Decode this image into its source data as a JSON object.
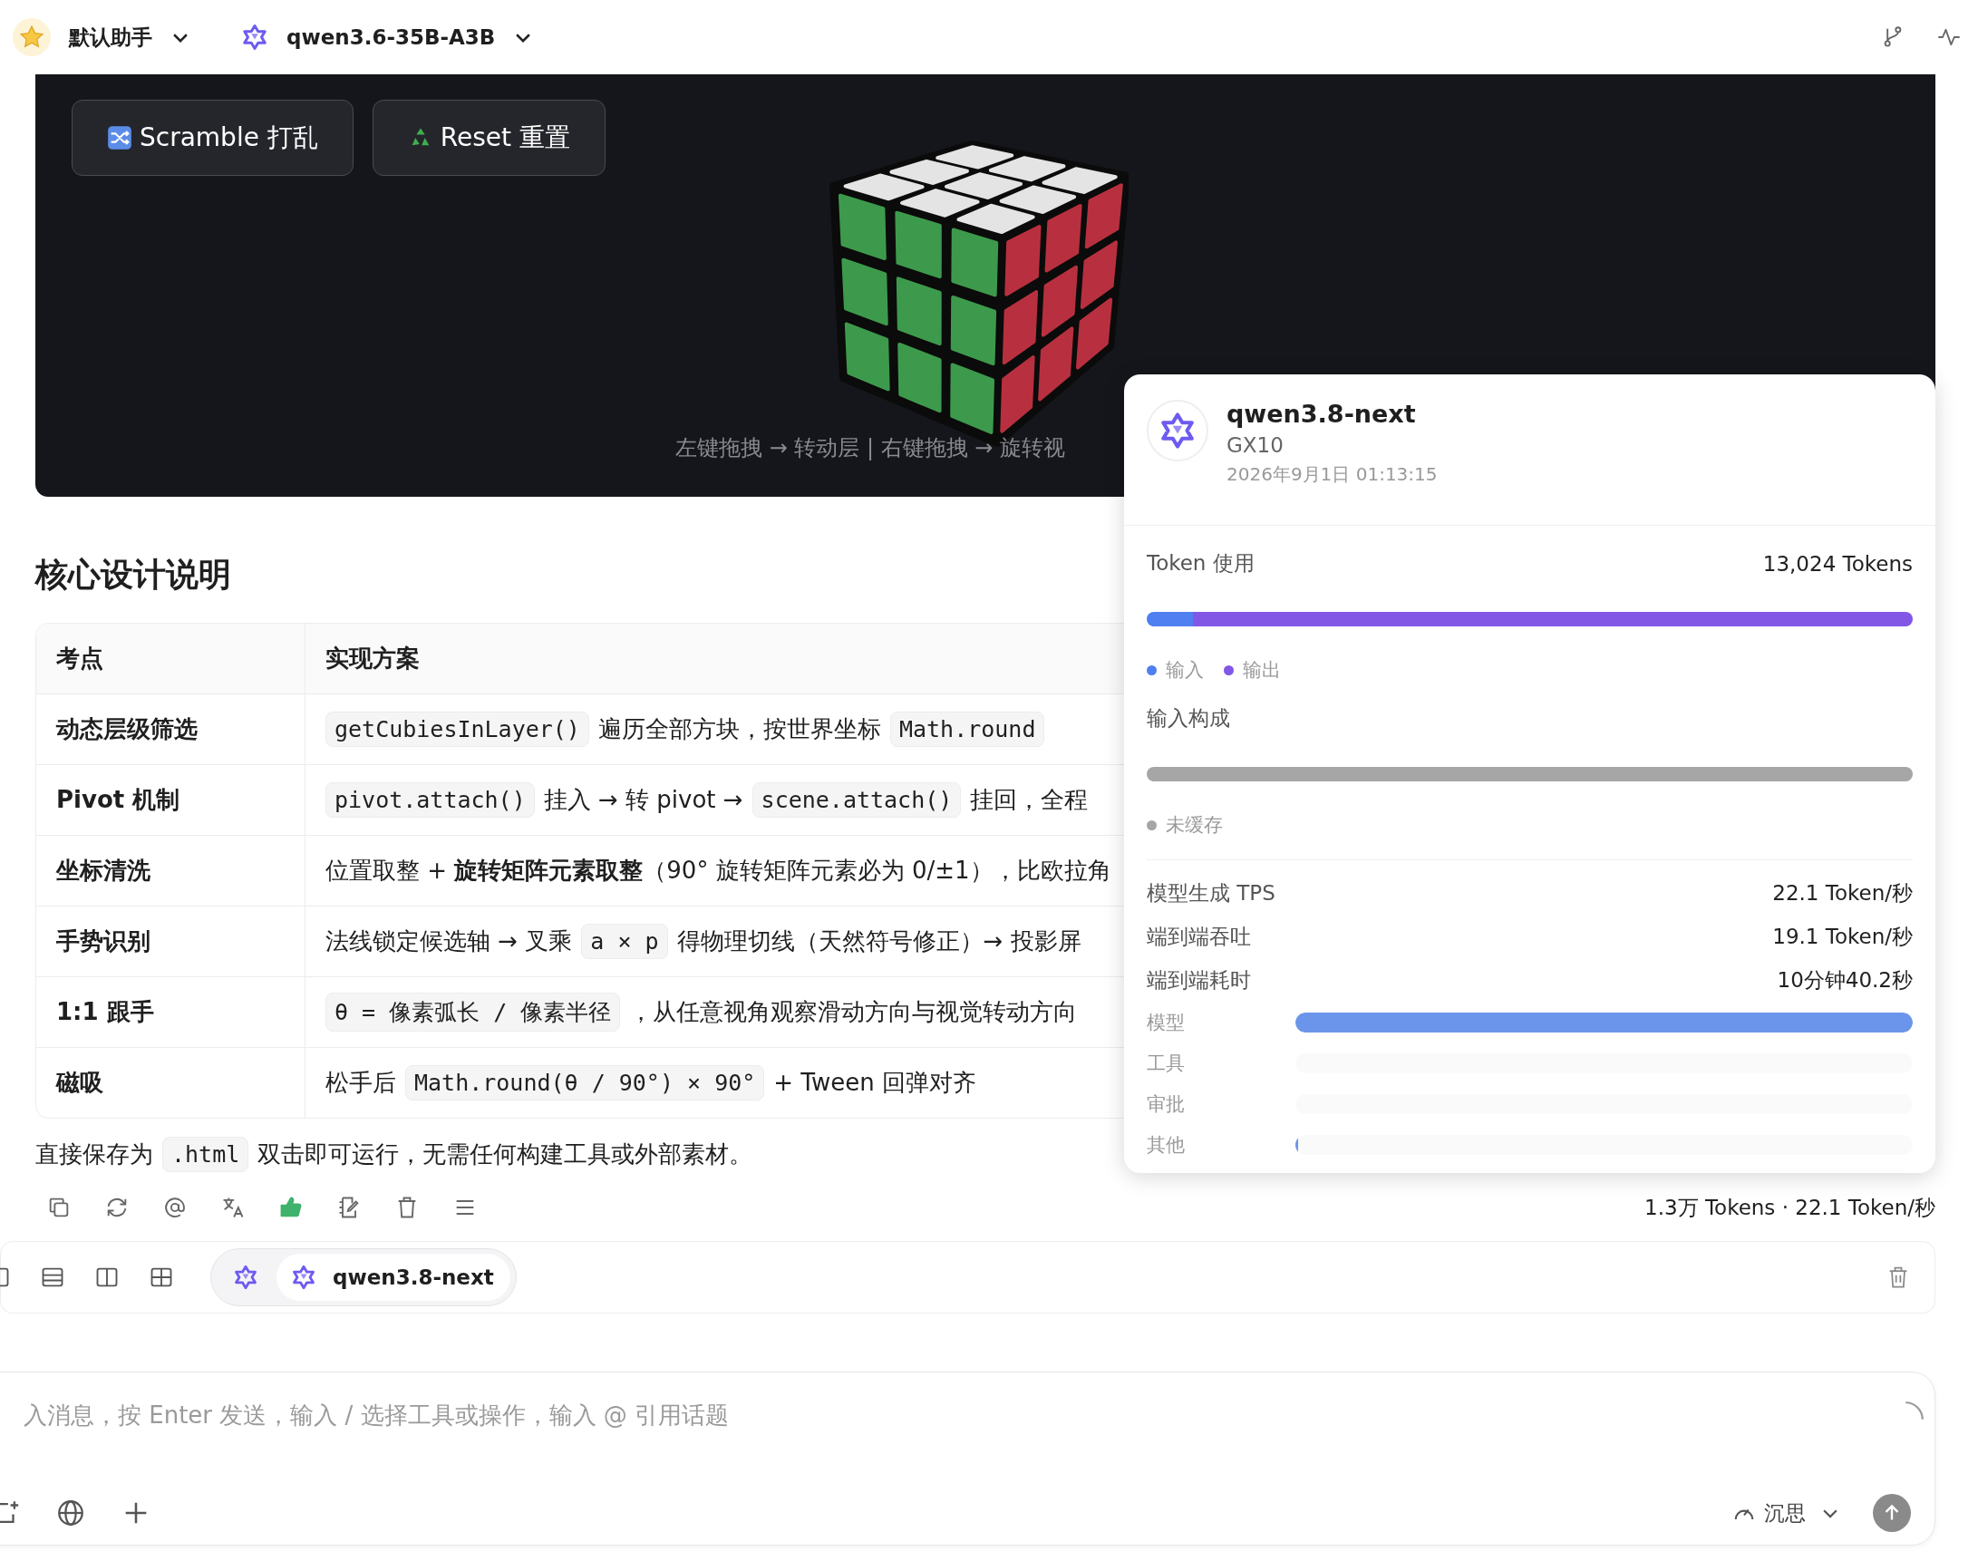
{
  "top_bar": {
    "assistant": "默认助手",
    "model": "qwen3.6-35B-A3B"
  },
  "demo": {
    "buttons": [
      {
        "kind": "shuffle",
        "label": "Scramble 打乱"
      },
      {
        "kind": "recycle",
        "label": "Reset 重置"
      }
    ],
    "hint": "左键拖拽 → 转动层 | 右键拖拽 → 旋转视"
  },
  "section_title": "核心设计说明",
  "table": {
    "columns": [
      "考点",
      "实现方案"
    ],
    "rows": [
      {
        "label": "动态层级筛选",
        "parts": [
          {
            "kind": "code",
            "text": "getCubiesInLayer()"
          },
          {
            "kind": "text",
            "text": "遍历全部方块，按世界坐标"
          },
          {
            "kind": "code",
            "text": "Math.round"
          }
        ]
      },
      {
        "label": "Pivot 机制",
        "parts": [
          {
            "kind": "code",
            "text": "pivot.attach()"
          },
          {
            "kind": "text",
            "text": "挂入 → 转 pivot →"
          },
          {
            "kind": "code",
            "text": "scene.attach()"
          },
          {
            "kind": "text",
            "text": "挂回，全程"
          }
        ]
      },
      {
        "label": "坐标清洗",
        "parts": [
          {
            "kind": "text",
            "text": "位置取整 + **旋转矩阵元素取整**（90° 旋转矩阵元素必为 0/±1），比欧拉角"
          }
        ]
      },
      {
        "label": "手势识别",
        "parts": [
          {
            "kind": "text",
            "text": "法线锁定候选轴 → 叉乘"
          },
          {
            "kind": "code",
            "text": "a × p"
          },
          {
            "kind": "text",
            "text": "得物理切线（天然符号修正）→ 投影屏"
          }
        ]
      },
      {
        "label": "1:1 跟手",
        "parts": [
          {
            "kind": "code",
            "text": "θ = 像素弧长 / 像素半径"
          },
          {
            "kind": "text",
            "text": "，从任意视角观察滑动方向与视觉转动方向"
          }
        ]
      },
      {
        "label": "磁吸",
        "parts": [
          {
            "kind": "text",
            "text": "松手后"
          },
          {
            "kind": "code",
            "text": "Math.round(θ / 90°) × 90°"
          },
          {
            "kind": "text",
            "text": "+ Tween 回弹对齐"
          }
        ]
      }
    ]
  },
  "note": [
    {
      "kind": "text",
      "text": "直接保存为"
    },
    {
      "kind": "code",
      "text": ".html"
    },
    {
      "kind": "text",
      "text": "双击即可运行，无需任何构建工具或外部素材。"
    }
  ],
  "message_actions": {
    "liked": true
  },
  "usage_summary": "1.3万 Tokens · 22.1 Token/秒",
  "model_bar": {
    "model": "qwen3.8-next"
  },
  "composer": {
    "placeholder": "入消息，按 Enter 发送，输入 / 选择工具或操作，输入 @ 引用话题",
    "mode": "沉思"
  },
  "popup": {
    "title": "qwen3.8-next",
    "subtitle": "GX10",
    "date": "2026年9月1日 01:13:15",
    "token_usage": {
      "label": "Token 使用",
      "value": "13,024 Tokens",
      "segments": [
        {
          "name": "输入",
          "level": 0.06,
          "color": "#4f7ff0"
        },
        {
          "name": "输出",
          "level": 0.94,
          "color": "#8257e6"
        }
      ]
    },
    "input_composition": {
      "label": "输入构成",
      "segments": [
        {
          "name": "未缓存",
          "level": 1,
          "color": "#a6a6a6"
        }
      ]
    },
    "stats": [
      {
        "label": "模型生成 TPS",
        "value": "22.1 Token/秒"
      },
      {
        "label": "端到端吞吐",
        "value": "19.1 Token/秒"
      },
      {
        "label": "端到端耗时",
        "value": "10分钟40.2秒"
      }
    ],
    "timing": [
      {
        "label": "模型",
        "level": 1
      },
      {
        "label": "工具",
        "level": 0
      },
      {
        "label": "审批",
        "level": 0
      },
      {
        "label": "其他",
        "level": 0.005
      }
    ]
  }
}
